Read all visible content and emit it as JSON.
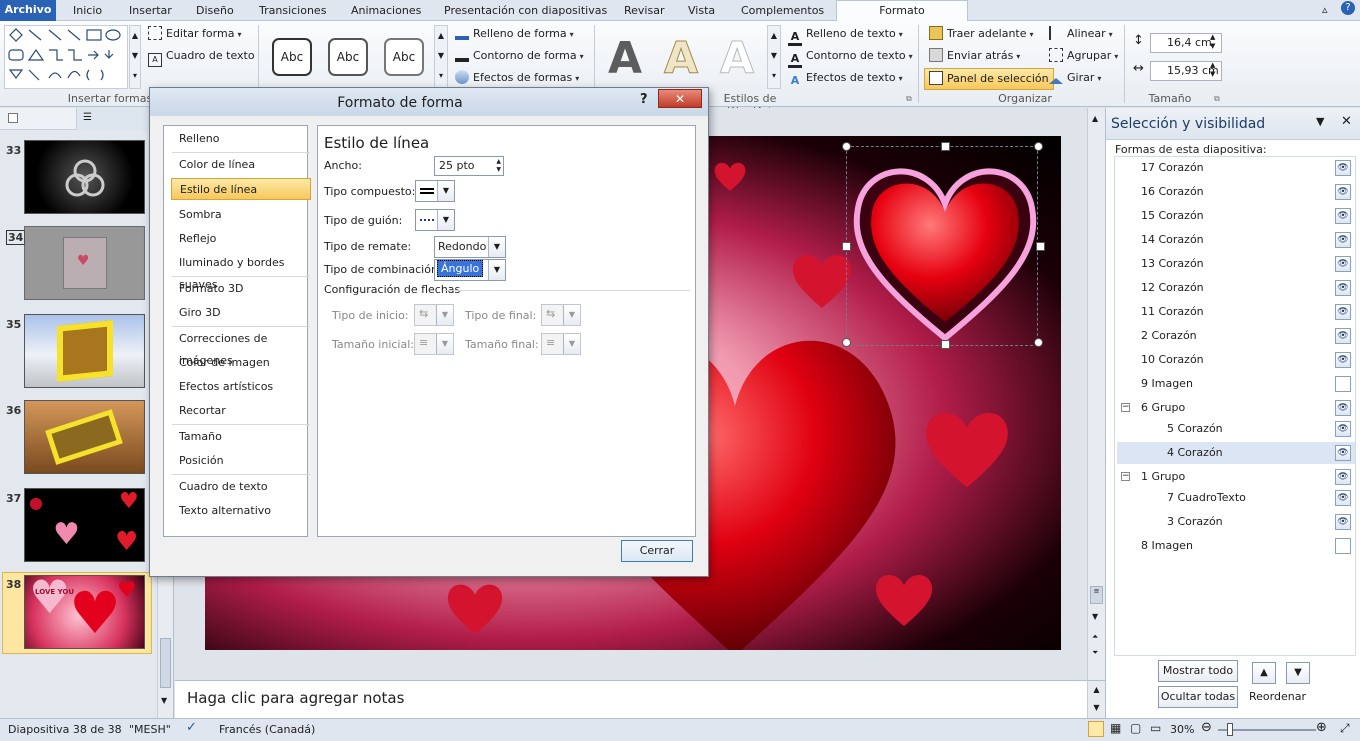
{
  "tabs": {
    "file": "Archivo",
    "items": [
      "Inicio",
      "Insertar",
      "Diseño",
      "Transiciones",
      "Animaciones",
      "Presentación con diapositivas",
      "Revisar",
      "Vista",
      "Complementos"
    ],
    "active": "Formato"
  },
  "ribbon": {
    "insert_shapes_label": "Insertar formas",
    "edit_shape": "Editar forma",
    "text_box": "Cuadro de texto",
    "style_samples": [
      "Abc",
      "Abc",
      "Abc"
    ],
    "shape_fill": "Relleno de forma",
    "shape_outline": "Contorno de forma",
    "shape_effects": "Efectos de formas",
    "wordart_letters": [
      "A",
      "A",
      "A"
    ],
    "text_fill": "Relleno de texto",
    "text_outline": "Contorno de texto",
    "text_effects": "Efectos de texto",
    "wordart_label": "Estilos de WordArt",
    "bring_forward": "Traer adelante",
    "send_backward": "Enviar atrás",
    "selection_pane": "Panel de selección",
    "align": "Alinear",
    "group": "Agrupar",
    "rotate": "Girar",
    "arrange_label": "Organizar",
    "height": "16,4 cm",
    "width": "15,93 cm",
    "size_label": "Tamaño"
  },
  "thumbnails": [
    {
      "num": "33"
    },
    {
      "num": "34"
    },
    {
      "num": "35"
    },
    {
      "num": "36"
    },
    {
      "num": "37"
    },
    {
      "num": "38"
    }
  ],
  "thumb_love_text": "LOVE YOU",
  "dialog": {
    "title": "Formato de forma",
    "help": "?",
    "close_glyph": "✕",
    "categories": [
      "Relleno",
      "Color de línea",
      "Estilo de línea",
      "Sombra",
      "Reflejo",
      "Iluminado y bordes suaves",
      "Formato 3D",
      "Giro 3D",
      "Correcciones de imágenes",
      "Color de imagen",
      "Efectos artísticos",
      "Recortar",
      "Tamaño",
      "Posición",
      "Cuadro de texto",
      "Texto alternativo"
    ],
    "selected_category": "Estilo de línea",
    "section_title": "Estilo de línea",
    "width_label": "Ancho:",
    "width_value": "25 pto",
    "compound_label": "Tipo compuesto:",
    "dash_label": "Tipo de guión:",
    "cap_label": "Tipo de remate:",
    "cap_value": "Redondo",
    "join_label": "Tipo de combinación:",
    "join_value": "Ángulo",
    "arrows_title": "Configuración de flechas",
    "begin_type": "Tipo de inicio:",
    "end_type": "Tipo de final:",
    "begin_size": "Tamaño inicial:",
    "end_size": "Tamaño final:",
    "close_button": "Cerrar"
  },
  "selection_pane": {
    "title": "Selección y visibilidad",
    "subtitle": "Formas de esta diapositiva:",
    "rows": [
      {
        "label": "17 Corazón",
        "indent": 0,
        "visible": true
      },
      {
        "label": "16 Corazón",
        "indent": 0,
        "visible": true
      },
      {
        "label": "15 Corazón",
        "indent": 0,
        "visible": true
      },
      {
        "label": "14 Corazón",
        "indent": 0,
        "visible": true
      },
      {
        "label": "13 Corazón",
        "indent": 0,
        "visible": true
      },
      {
        "label": "12 Corazón",
        "indent": 0,
        "visible": true
      },
      {
        "label": "11 Corazón",
        "indent": 0,
        "visible": true
      },
      {
        "label": "2 Corazón",
        "indent": 0,
        "visible": true
      },
      {
        "label": "10 Corazón",
        "indent": 0,
        "visible": true
      },
      {
        "label": "9 Imagen",
        "indent": 0,
        "visible": false
      },
      {
        "label": "6 Grupo",
        "indent": 0,
        "visible": true,
        "group": true
      },
      {
        "label": "5 Corazón",
        "indent": 1,
        "visible": true
      },
      {
        "label": "4 Corazón",
        "indent": 1,
        "visible": true,
        "selected": true
      },
      {
        "label": "1 Grupo",
        "indent": 0,
        "visible": true,
        "group": true
      },
      {
        "label": "7 CuadroTexto",
        "indent": 1,
        "visible": true
      },
      {
        "label": "3 Corazón",
        "indent": 1,
        "visible": true
      },
      {
        "label": "8 Imagen",
        "indent": 0,
        "visible": false
      }
    ],
    "show_all": "Mostrar todo",
    "hide_all": "Ocultar todas",
    "reorder": "Reordenar"
  },
  "notes_placeholder": "Haga clic para agregar notas",
  "status": {
    "slide": "Diapositiva 38 de 38",
    "theme": "\"MESH\"",
    "language": "Francés (Canadá)",
    "zoom": "30%"
  },
  "colors": {
    "accent": "#2a63b5",
    "selected_category": "#fbd46a",
    "selected_row": "#dbe5f3"
  }
}
